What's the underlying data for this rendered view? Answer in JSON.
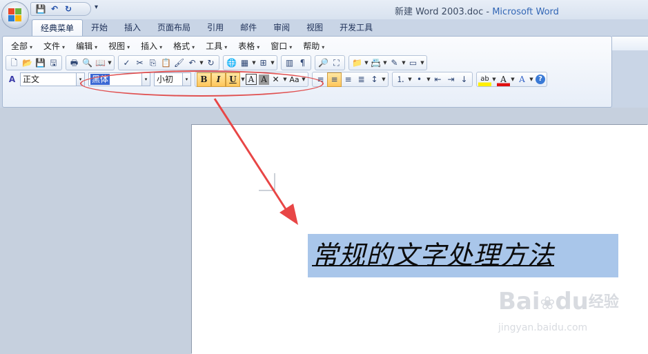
{
  "window": {
    "doc_title": "新建 Word 2003.doc",
    "separator": " - ",
    "app_name": "Microsoft Word"
  },
  "quick_access": {
    "items": [
      {
        "name": "save-icon",
        "glyph": "💾"
      },
      {
        "name": "undo-icon",
        "glyph": "↶"
      },
      {
        "name": "redo-icon",
        "glyph": "↻"
      }
    ],
    "customize_glyph": "▾"
  },
  "tabs": [
    "经典菜单",
    "开始",
    "插入",
    "页面布局",
    "引用",
    "邮件",
    "审阅",
    "视图",
    "开发工具"
  ],
  "active_tab": "经典菜单",
  "menu": [
    "全部",
    "文件",
    "编辑",
    "视图",
    "插入",
    "格式",
    "工具",
    "表格",
    "窗口",
    "帮助"
  ],
  "toolbar_row1": [
    {
      "name": "new-doc-icon",
      "glyph": "🗋"
    },
    {
      "name": "open-folder-icon",
      "glyph": "📂"
    },
    {
      "name": "save-icon",
      "glyph": "💾"
    },
    {
      "name": "permission-icon",
      "glyph": "🖫"
    },
    {
      "name": "print-icon",
      "glyph": "🖶"
    },
    {
      "name": "print-preview-icon",
      "glyph": "🔍"
    },
    {
      "name": "research-icon",
      "glyph": "📖"
    },
    {
      "name": "spelling-icon",
      "glyph": "✓"
    },
    {
      "name": "cut-icon",
      "glyph": "✂"
    },
    {
      "name": "copy-icon",
      "glyph": "⎘"
    },
    {
      "name": "paste-icon",
      "glyph": "📋"
    },
    {
      "name": "format-painter-icon",
      "glyph": "🖌"
    },
    {
      "name": "undo-icon",
      "glyph": "↶"
    },
    {
      "name": "redo-icon",
      "glyph": "↻"
    },
    {
      "name": "hyperlink-icon",
      "glyph": "🌐"
    },
    {
      "name": "table-grid-icon",
      "glyph": "▦"
    },
    {
      "name": "insert-table-icon",
      "glyph": "⊞"
    },
    {
      "name": "columns-icon",
      "glyph": "▥"
    },
    {
      "name": "show-marks-icon",
      "glyph": "¶"
    },
    {
      "name": "zoom-icon",
      "glyph": "🔎"
    },
    {
      "name": "full-screen-icon",
      "glyph": "⛶"
    },
    {
      "name": "folder-icon",
      "glyph": "📁"
    },
    {
      "name": "address-book-icon",
      "glyph": "📇"
    },
    {
      "name": "edit-icon",
      "glyph": "✎"
    },
    {
      "name": "options-icon",
      "glyph": "▭"
    }
  ],
  "formatting": {
    "style_glyph": "A",
    "style_value": "正文",
    "font_value": "黑体",
    "size_value": "小初",
    "bold_label": "B",
    "italic_label": "I",
    "underline_label": "U",
    "border_char_label": "A",
    "shade_char_label": "A",
    "char_scale_glyph": "✕",
    "change_case_label": "Aa",
    "align_left_glyph": "≡",
    "center_glyph": "≡",
    "align_right_glyph": "≡",
    "justify_glyph": "≣",
    "line_spacing_glyph": "↕",
    "numbering_glyph": "⒈",
    "bullets_glyph": "•",
    "decrease_indent_glyph": "⇤",
    "increase_indent_glyph": "⇥",
    "sort_glyph": "↓",
    "highlight_label": "ab",
    "font_color_label": "A",
    "text_effects_label": "A",
    "help_glyph": "?"
  },
  "document": {
    "heading_text": "常规的文字处理方法"
  },
  "watermark": {
    "brand": "Bai",
    "brand_suffix": "du",
    "cn": "经验",
    "url": "jingyan.baidu.com"
  },
  "colors": {
    "selection": "#a9c6ea",
    "annotation": "#e05050",
    "app_title": "#3266b5"
  }
}
